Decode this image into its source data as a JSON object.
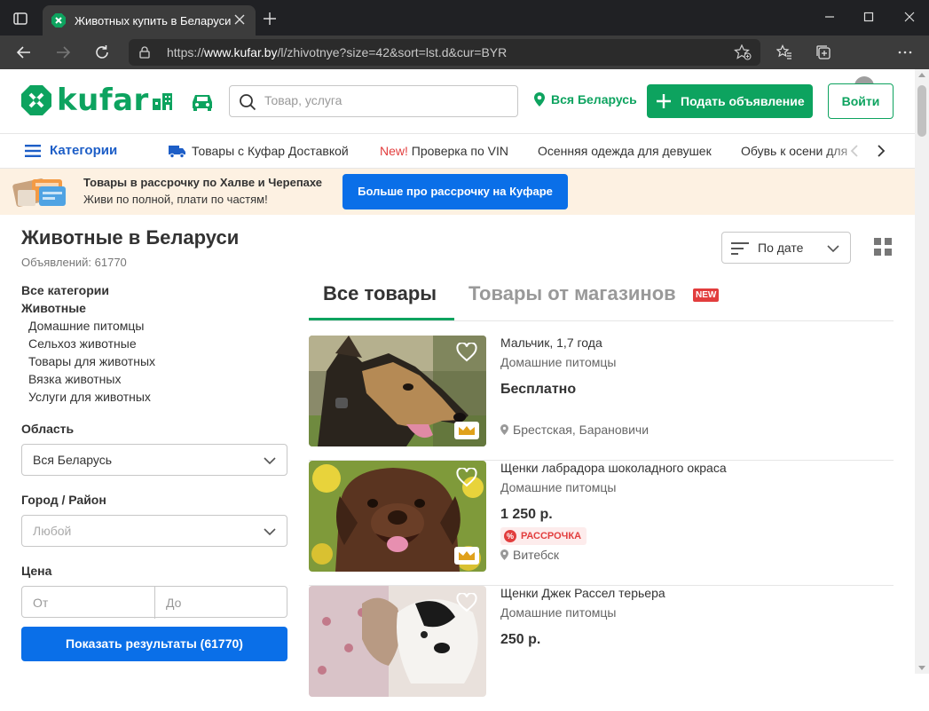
{
  "browser": {
    "tab_title": "Животных купить в Беларуси",
    "url_prefix": "https://",
    "url_domain": "www.kufar.by",
    "url_path": "/l/zhivotnye?size=42&sort=lst.d&cur=BYR"
  },
  "header": {
    "logo_text": "kufar",
    "search_placeholder": "Товар, услуга",
    "region": "Вся Беларусь",
    "post_button": "Подать объявление",
    "login_button": "Войти",
    "brand_color": "#0da35f"
  },
  "category_bar": {
    "categories_button": "Категории",
    "links": [
      {
        "label": "Товары с Куфар Доставкой"
      },
      {
        "prefix": "New!",
        "label": "Проверка по VIN"
      },
      {
        "label": "Осенняя одежда для девушек"
      },
      {
        "label": "Обувь к осени для"
      }
    ]
  },
  "promo": {
    "title": "Товары в рассрочку по Халве и Черепахе",
    "subtitle": "Живи по полной, плати по частям!",
    "button": "Больше про рассрочку на Куфаре"
  },
  "page": {
    "title": "Животные в Беларуси",
    "ad_count": "Объявлений: 61770"
  },
  "category_tree": [
    {
      "label": "Все категории",
      "level": 0
    },
    {
      "label": "Животные",
      "level": 0
    },
    {
      "label": "Домашние питомцы",
      "level": 1
    },
    {
      "label": "Сельхоз животные",
      "level": 1
    },
    {
      "label": "Товары для животных",
      "level": 1
    },
    {
      "label": "Вязка животных",
      "level": 1
    },
    {
      "label": "Услуги для животных",
      "level": 1
    }
  ],
  "filters": {
    "region_label": "Область",
    "region_value": "Вся Беларусь",
    "city_label": "Город / Район",
    "city_placeholder": "Любой",
    "price_label": "Цена",
    "price_from_placeholder": "От",
    "price_to_placeholder": "До",
    "show_button": "Показать результаты (61770)"
  },
  "sort": {
    "value": "По дате"
  },
  "tabs": {
    "all": "Все товары",
    "shops": "Товары от магазинов",
    "new_badge": "NEW"
  },
  "listings": [
    {
      "title": "Мальчик, 1,7 года",
      "category": "Домашние питомцы",
      "price": "Бесплатно",
      "installment": "",
      "location": "Брестская, Барановичи"
    },
    {
      "title": "Щенки лабрадора шоколадного окраса",
      "category": "Домашние питомцы",
      "price": "1 250 р.",
      "installment": "РАССРОЧКА",
      "location": "Витебск"
    },
    {
      "title": "Щенки Джек Рассел терьера",
      "category": "Домашние питомцы",
      "price": "250 р.",
      "installment": "",
      "location": ""
    }
  ]
}
